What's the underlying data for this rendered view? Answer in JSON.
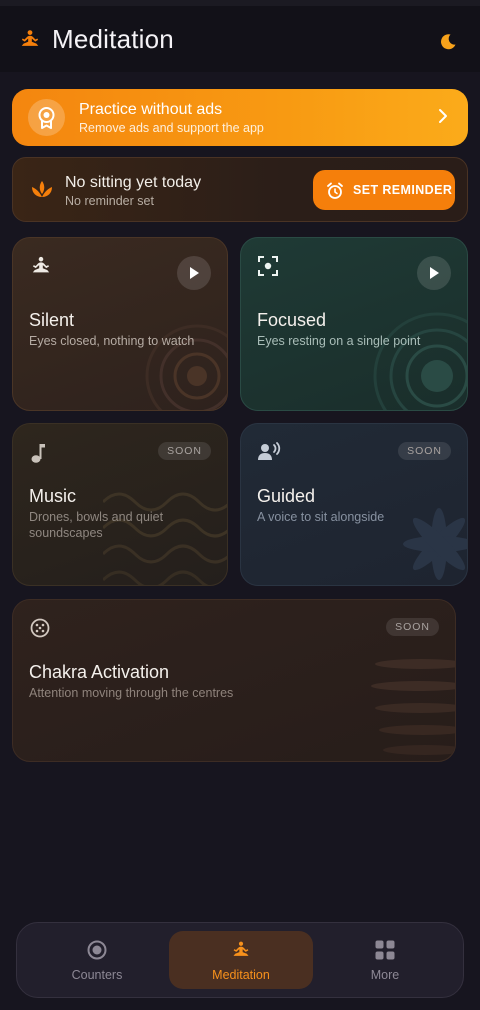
{
  "header": {
    "title": "Meditation",
    "logo_icon": "meditation-icon",
    "theme_icon": "moon-icon",
    "accent": "#f57f0b"
  },
  "ads_banner": {
    "title": "Practice without ads",
    "subtitle": "Remove ads and support the app",
    "icon": "badge-icon"
  },
  "reminder": {
    "title": "No sitting yet today",
    "subtitle": "No reminder set",
    "button_label": "SET REMINDER",
    "icon": "lotus-icon",
    "button_icon": "alarm-icon"
  },
  "tiles": [
    {
      "id": "silent",
      "title": "Silent",
      "subtitle": "Eyes closed, nothing to watch",
      "icon": "meditation-icon",
      "action": "play"
    },
    {
      "id": "focused",
      "title": "Focused",
      "subtitle": "Eyes resting on a single point",
      "icon": "focus-icon",
      "action": "play"
    },
    {
      "id": "music",
      "title": "Music",
      "subtitle": "Drones, bowls and quiet soundscapes",
      "icon": "music-note-icon",
      "badge": "SOON"
    },
    {
      "id": "guided",
      "title": "Guided",
      "subtitle": "A voice to sit alongside",
      "icon": "voice-icon",
      "badge": "SOON"
    },
    {
      "id": "chakra",
      "title": "Chakra Activation",
      "subtitle": "Attention moving through the centres",
      "icon": "chakra-icon",
      "badge": "SOON"
    }
  ],
  "bottom_nav": {
    "items": [
      {
        "label": "Counters",
        "icon": "target-icon",
        "active": false
      },
      {
        "label": "Meditation",
        "icon": "meditation-icon",
        "active": true
      },
      {
        "label": "More",
        "icon": "grid-icon",
        "active": false
      }
    ]
  }
}
